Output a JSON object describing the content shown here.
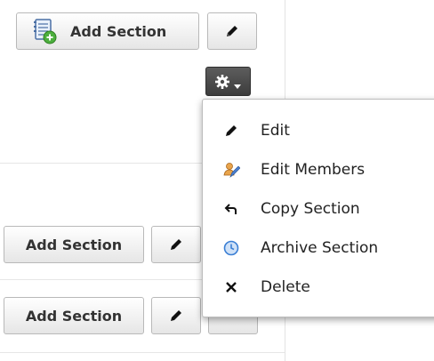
{
  "top": {
    "add_section_label": "Add Section"
  },
  "settings_menu": {
    "items": [
      {
        "label": "Edit",
        "icon": "pencil-icon"
      },
      {
        "label": "Edit Members",
        "icon": "members-icon"
      },
      {
        "label": "Copy Section",
        "icon": "undo-arrow-icon"
      },
      {
        "label": "Archive Section",
        "icon": "clock-icon"
      },
      {
        "label": "Delete",
        "icon": "x-icon"
      }
    ]
  },
  "rows": [
    {
      "add_section_label": "Add Section"
    },
    {
      "add_section_label": "Add Section"
    }
  ],
  "colors": {
    "menu_border": "#bdbdbd",
    "dark_button": "#4a4a4a",
    "archive_icon_blue": "#3b7fd4"
  }
}
